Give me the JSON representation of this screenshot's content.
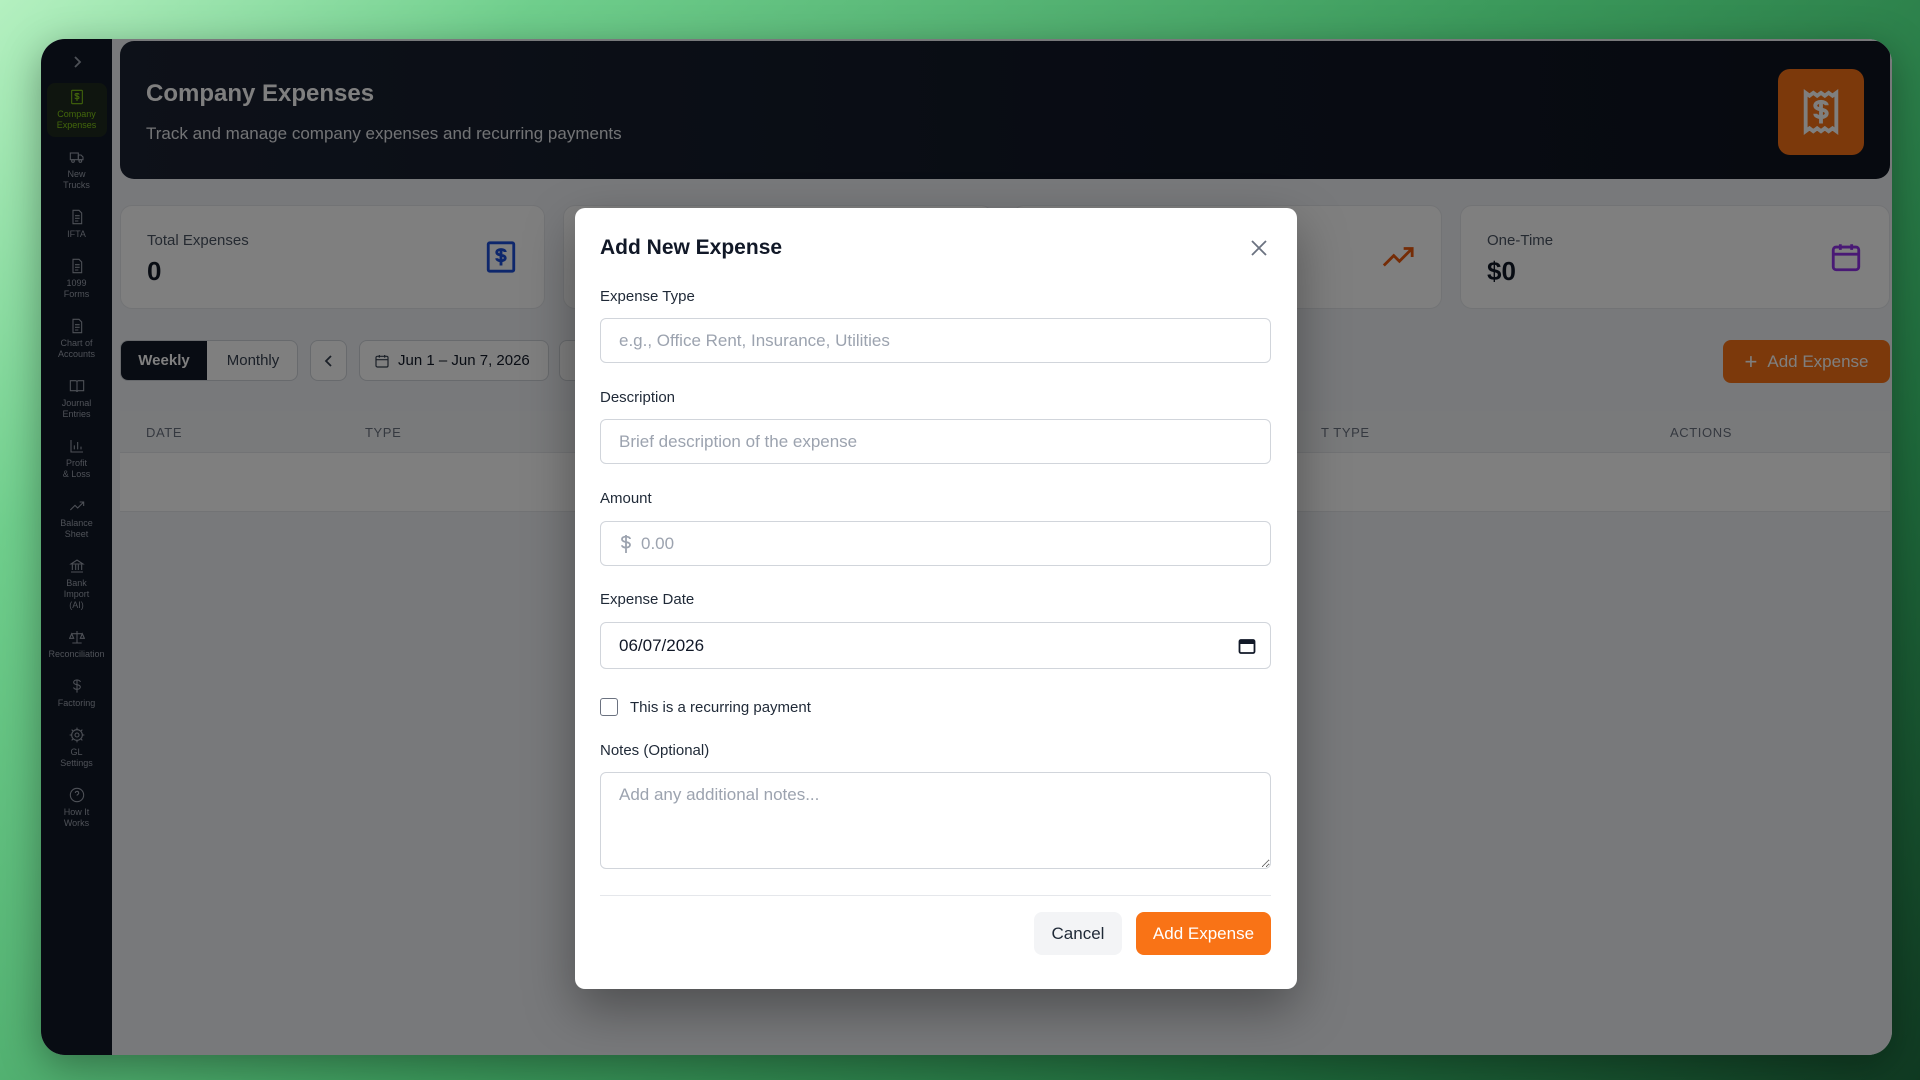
{
  "sidebar": {
    "toggle_icon": "chevron-right-icon",
    "items": [
      {
        "label": "Company\nExpenses",
        "icon": "receipt-dollar-icon",
        "active": true
      },
      {
        "label": "New\nTrucks",
        "icon": "truck-icon"
      },
      {
        "label": "IFTA",
        "icon": "document-icon"
      },
      {
        "label": "1099\nForms",
        "icon": "document-icon"
      },
      {
        "label": "Chart of\nAccounts",
        "icon": "document-icon"
      },
      {
        "label": "Journal\nEntries",
        "icon": "book-icon"
      },
      {
        "label": "Profit\n& Loss",
        "icon": "bar-chart-icon"
      },
      {
        "label": "Balance\nSheet",
        "icon": "trend-up-icon"
      },
      {
        "label": "Bank\nImport\n(AI)",
        "icon": "bank-icon"
      },
      {
        "label": "Reconciliation",
        "icon": "scale-icon"
      },
      {
        "label": "Factoring",
        "icon": "dollar-icon"
      },
      {
        "label": "GL\nSettings",
        "icon": "gear-icon"
      },
      {
        "label": "How It\nWorks",
        "icon": "help-circle-icon"
      }
    ]
  },
  "header": {
    "title": "Company Expenses",
    "subtitle": "Track and manage company expenses and recurring payments",
    "icon": "receipt-dollar-icon",
    "accent": "#f97316"
  },
  "stats": {
    "total": {
      "label": "Total Expenses",
      "value": "0",
      "icon": "receipt-dollar-icon",
      "color": "#1d4ed8"
    },
    "recurring": {
      "icon": "trend-up-icon",
      "color": "#ea580c"
    },
    "onetime": {
      "label": "One-Time",
      "value": "$0",
      "icon": "calendar-icon",
      "color": "#9333ea"
    }
  },
  "toolbar": {
    "weekly": "Weekly",
    "monthly": "Monthly",
    "prev_icon": "chevron-left-icon",
    "date_range": "Jun 1 – Jun 7, 2026",
    "next_icon": "chevron-right-icon",
    "add_label": "Add Expense"
  },
  "table": {
    "headers": {
      "date": "DATE",
      "type": "TYPE",
      "payment_type": "T TYPE",
      "actions": "ACTIONS"
    }
  },
  "modal": {
    "title": "Add New Expense",
    "close_icon": "close-icon",
    "expense_type": {
      "label": "Expense Type",
      "value": "",
      "placeholder": "e.g., Office Rent, Insurance, Utilities"
    },
    "description": {
      "label": "Description",
      "value": "",
      "placeholder": "Brief description of the expense"
    },
    "amount": {
      "label": "Amount",
      "value": "",
      "placeholder": "0.00",
      "icon": "dollar-icon"
    },
    "expense_date": {
      "label": "Expense Date",
      "value": "06/07/2026",
      "icon": "calendar-icon"
    },
    "recurring": {
      "label": "This is a recurring payment",
      "checked": false
    },
    "notes": {
      "label": "Notes (Optional)",
      "value": "",
      "placeholder": "Add any additional notes..."
    },
    "cancel_label": "Cancel",
    "submit_label": "Add Expense"
  }
}
